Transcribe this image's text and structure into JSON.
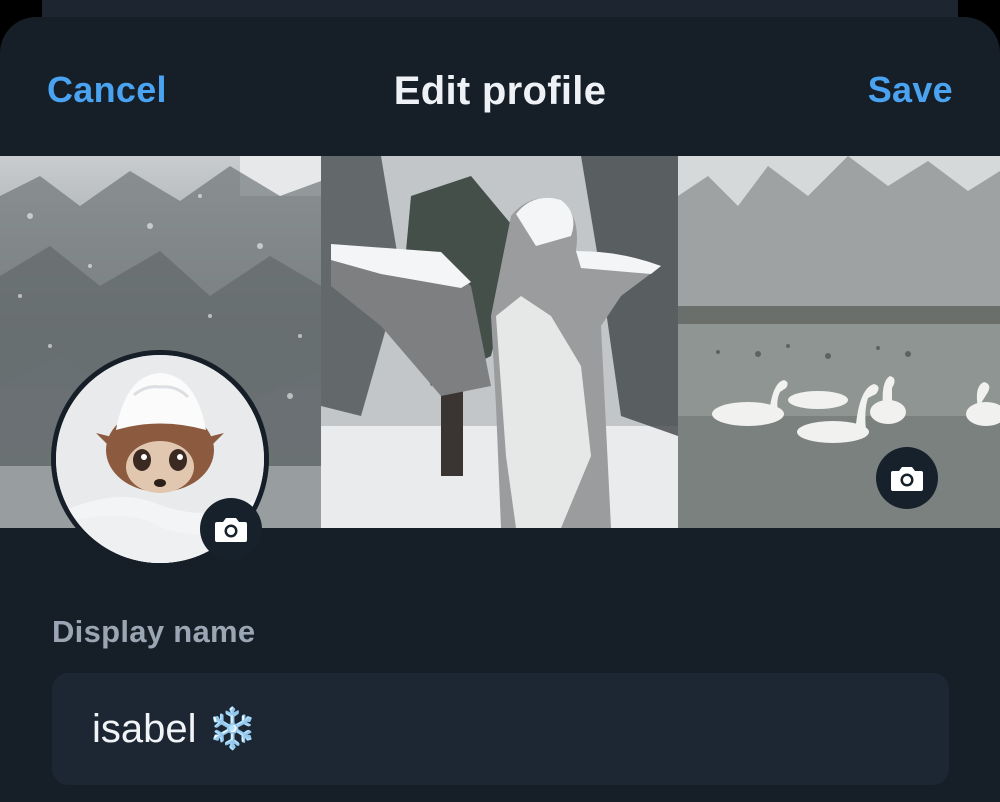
{
  "header": {
    "cancel_label": "Cancel",
    "title": "Edit profile",
    "save_label": "Save"
  },
  "banner": {
    "panels": [
      "snowy-forest-photo",
      "snow-covered-angel-statue-photo",
      "swans-on-lake-photo"
    ],
    "change_icon": "camera-icon"
  },
  "avatar": {
    "image": "fawn-in-snow-photo",
    "change_icon": "camera-icon"
  },
  "display_name": {
    "label": "Display name",
    "value": "isabel ❄️"
  },
  "colors": {
    "accent": "#4aa3f0",
    "background": "#161e27",
    "field": "#1d2734"
  }
}
